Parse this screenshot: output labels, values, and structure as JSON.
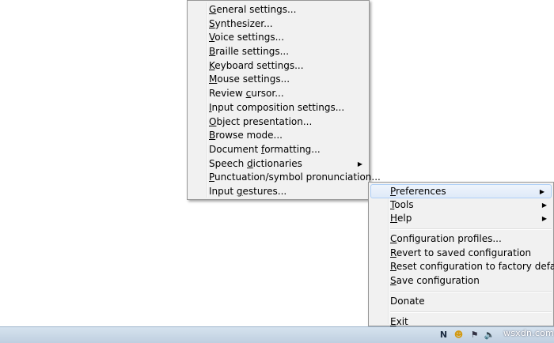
{
  "submenu": {
    "items": [
      {
        "pre": "",
        "u": "G",
        "post": "eneral settings..."
      },
      {
        "pre": "",
        "u": "S",
        "post": "ynthesizer..."
      },
      {
        "pre": "",
        "u": "V",
        "post": "oice settings..."
      },
      {
        "pre": "",
        "u": "B",
        "post": "raille settings..."
      },
      {
        "pre": "",
        "u": "K",
        "post": "eyboard settings..."
      },
      {
        "pre": "",
        "u": "M",
        "post": "ouse settings..."
      },
      {
        "pre": "Review ",
        "u": "c",
        "post": "ursor..."
      },
      {
        "pre": "",
        "u": "I",
        "post": "nput composition settings..."
      },
      {
        "pre": "",
        "u": "O",
        "post": "bject presentation..."
      },
      {
        "pre": "",
        "u": "B",
        "post": "rowse mode..."
      },
      {
        "pre": "Document ",
        "u": "f",
        "post": "ormatting..."
      },
      {
        "pre": "Speech ",
        "u": "d",
        "post": "ictionaries"
      },
      {
        "pre": "",
        "u": "P",
        "post": "unctuation/symbol pronunciation..."
      },
      {
        "pre": "Input ",
        "u": "g",
        "post": "estures..."
      }
    ],
    "submenu_arrow": "▶"
  },
  "mainmenu": {
    "items": [
      {
        "pre": "",
        "u": "P",
        "post": "references"
      },
      {
        "pre": "",
        "u": "T",
        "post": "ools"
      },
      {
        "pre": "",
        "u": "H",
        "post": "elp"
      },
      {
        "pre": "",
        "u": "C",
        "post": "onfiguration profiles..."
      },
      {
        "pre": "",
        "u": "R",
        "post": "evert to saved configuration"
      },
      {
        "pre": "",
        "u": "R",
        "post": "eset configuration to factory defaults"
      },
      {
        "pre": "",
        "u": "S",
        "post": "ave configuration"
      },
      {
        "pre": "",
        "u": "",
        "post": "Donate"
      },
      {
        "pre": "",
        "u": "E",
        "post": "xit"
      }
    ],
    "submenu_arrow": "▶"
  },
  "tray": {
    "nvda_glyph": "N",
    "smile_glyph": "☻",
    "flag_glyph": "⚑",
    "speaker_glyph": "🔈",
    "watermark": "wsxdn.com"
  },
  "colors": {
    "menu_bg": "#f1f1f1",
    "highlight": "#dfeaf8",
    "taskbar": "#c9d8e7"
  }
}
